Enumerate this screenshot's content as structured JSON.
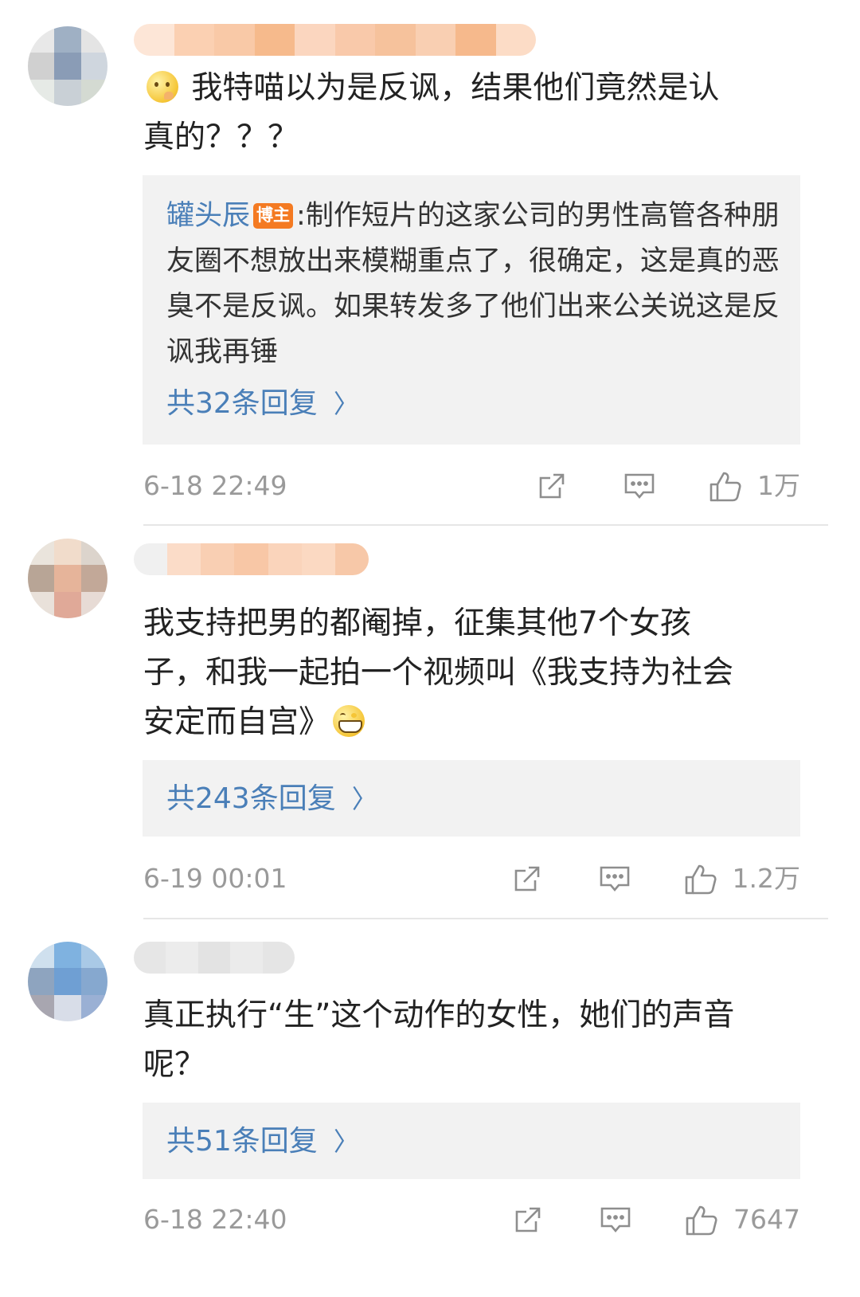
{
  "comments": [
    {
      "text_lines": [
        "我特喵以为是反讽，结果他们竟然是认",
        "真的？？？"
      ],
      "emoji_lead": "thinking-emoji",
      "reply_preview": {
        "author": "罐头辰",
        "badge": "博主",
        "separator": ":",
        "text": "制作短片的这家公司的男性高管各种朋友圈不想放出来模糊重点了，很确定，这是真的恶臭不是反讽。如果转发多了他们出来公关说这是反讽我再锤"
      },
      "reply_count": "共32条回复",
      "time": "6-18 22:49",
      "likes": "1万"
    },
    {
      "text_lines": [
        "我支持把男的都阉掉，征集其他7个女孩",
        "子，和我一起拍一个视频叫《我支持为社会",
        "安定而自宫》"
      ],
      "emoji_trail": "grinning-emoji",
      "reply_count": "共243条回复",
      "time": "6-19 00:01",
      "likes": "1.2万"
    },
    {
      "text_lines": [
        "真正执行“生”这个动作的女性，她们的声音",
        "呢？"
      ],
      "reply_count": "共51条回复",
      "time": "6-18 22:40",
      "likes": "7647"
    }
  ],
  "colors": {
    "link_blue": "#4a7fb8",
    "badge_orange": "#f47a22",
    "meta_gray": "#9a9a9a",
    "reply_bg": "#f2f2f2"
  },
  "icons": {
    "share": "share-icon",
    "comment": "comment-icon",
    "like": "like-icon",
    "chevron": "chevron-right-icon"
  },
  "chevron_glyph": "〉"
}
